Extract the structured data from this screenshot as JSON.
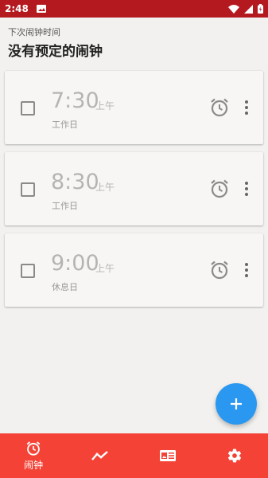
{
  "status_bar": {
    "time": "2:48"
  },
  "header": {
    "subtitle": "下次闹钟时间",
    "title": "没有预定的闹钟"
  },
  "alarms": [
    {
      "time": "7:30",
      "ampm": "上午",
      "label": "工作日",
      "enabled": false
    },
    {
      "time": "8:30",
      "ampm": "上午",
      "label": "工作日",
      "enabled": false
    },
    {
      "time": "9:00",
      "ampm": "上午",
      "label": "休息日",
      "enabled": false
    }
  ],
  "bottom_nav": {
    "items": [
      {
        "label": "闹钟",
        "icon": "alarm-clock-icon",
        "active": true
      },
      {
        "label": "",
        "icon": "stats-chart-icon",
        "active": false
      },
      {
        "label": "",
        "icon": "news-card-icon",
        "active": false
      },
      {
        "label": "",
        "icon": "gear-icon",
        "active": false
      }
    ]
  },
  "colors": {
    "status_bar": "#b3191f",
    "bottom_nav": "#f44336",
    "fab": "#2a98f0",
    "background": "#f2f1ef"
  }
}
